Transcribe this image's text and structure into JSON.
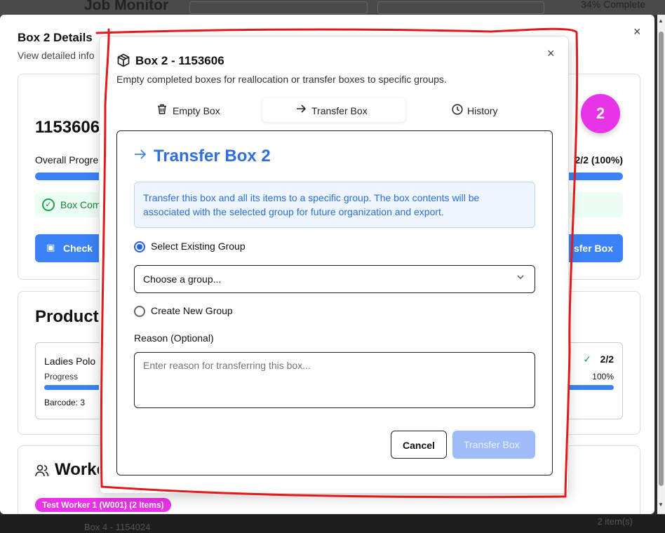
{
  "background": {
    "app_title": "Job Monitor",
    "progress_text": "34% Complete",
    "footer_text": "Box 4 - 1154024",
    "footer_right": "2 item(s)"
  },
  "outer_dialog": {
    "title": "Box 2 Details",
    "subtitle": "View detailed info",
    "close": "×",
    "box_number": "1153606",
    "overall_label": "Overall Progre",
    "overall_count": "2/2 (100%)",
    "status_text": "Box Com",
    "check_button": "Check",
    "transfer_button": "sfer Box",
    "products_title": "Product",
    "product": {
      "name": "Ladies Polo",
      "progress_label": "Progress",
      "barcode": "Barcode: 3",
      "count": "2/2",
      "percent": "100%"
    },
    "workers_title": "Worke",
    "worker_tag": "Test Worker 1 (W001) (2 Items)"
  },
  "inner_dialog": {
    "title": "Box 2 - 1153606",
    "subtitle": "Empty completed boxes for reallocation or transfer boxes to specific groups.",
    "close": "×",
    "tabs": [
      {
        "label": "Empty Box",
        "icon": "trash-icon"
      },
      {
        "label": "Transfer Box",
        "icon": "arrow-right-icon"
      },
      {
        "label": "History",
        "icon": "clock-icon"
      }
    ],
    "panel": {
      "title": "Transfer Box 2",
      "info": "Transfer this box and all its items to a specific group. The box contents will be associated with the selected group for future organization and export.",
      "option_existing": "Select Existing Group",
      "select_placeholder": "Choose a group...",
      "option_new": "Create New Group",
      "reason_label": "Reason (Optional)",
      "reason_placeholder": "Enter reason for transferring this box...",
      "cancel": "Cancel",
      "submit": "Transfer Box"
    }
  },
  "annotation": {
    "badge": "2",
    "color": "#e834e8",
    "outline_color": "#e01b1b"
  }
}
